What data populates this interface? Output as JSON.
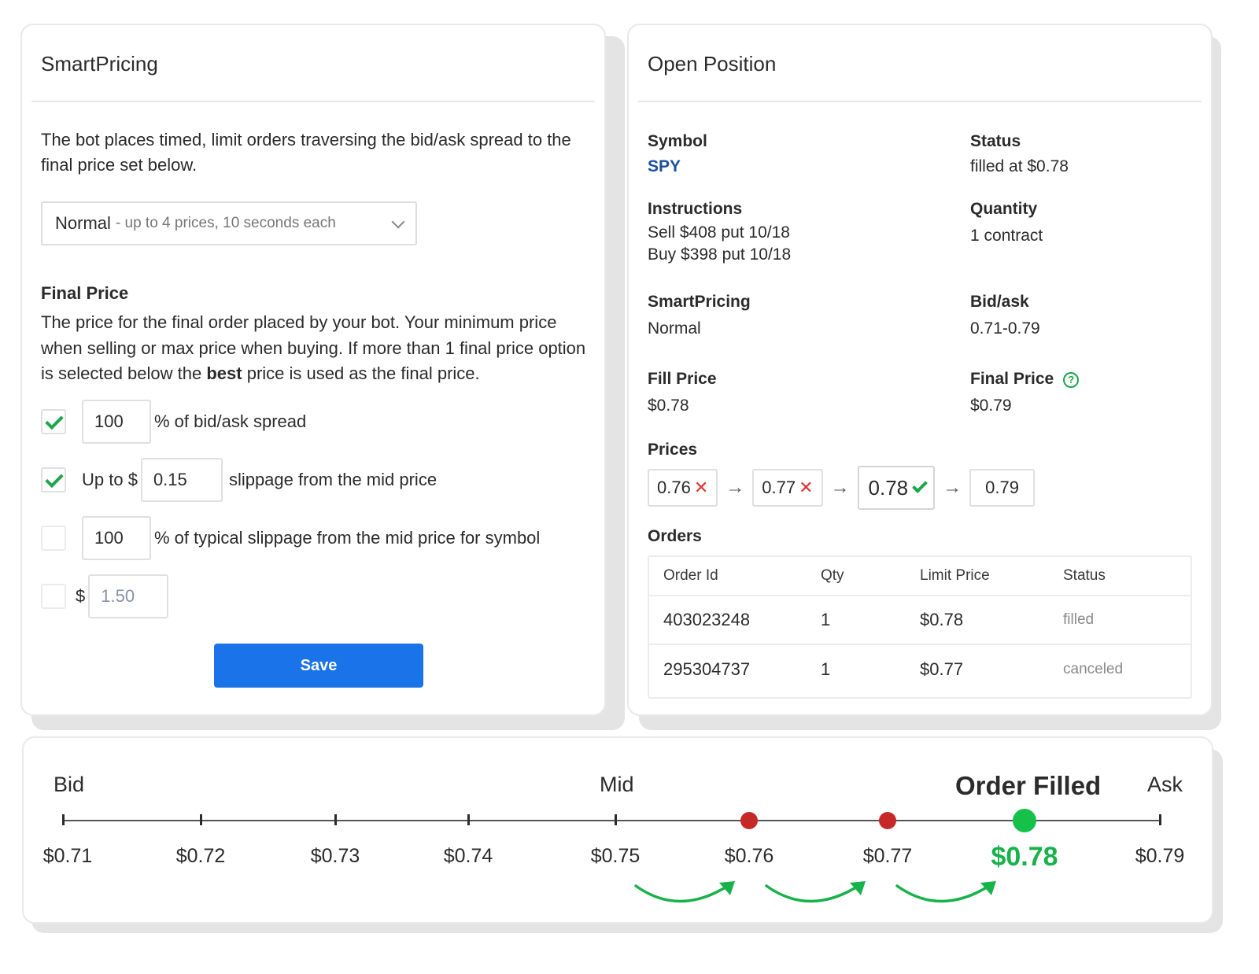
{
  "smart_pricing": {
    "title": "SmartPricing",
    "description": "The bot places timed, limit orders traversing the bid/ask spread to the final price set below.",
    "mode_select": {
      "value": "Normal",
      "detail": "- up to 4 prices, 10 seconds each"
    },
    "final_price": {
      "title": "Final Price",
      "desc_before": "The price for the final order placed by your bot. Your minimum price when selling or max price when buying. If more than 1 final price option is selected below the ",
      "desc_bold": "best",
      "desc_after": " price is used as the final price."
    },
    "options": [
      {
        "checked": true,
        "value": "100",
        "suffix": "% of bid/ask spread"
      },
      {
        "checked": true,
        "prefix": "Up to $",
        "value": "0.15",
        "suffix": "slippage from the mid price"
      },
      {
        "checked": false,
        "value": "100",
        "suffix": "% of typical slippage from the mid price for symbol"
      },
      {
        "checked": false,
        "prefix": "$",
        "value": "1.50"
      }
    ],
    "save_label": "Save"
  },
  "open_position": {
    "title": "Open Position",
    "symbol_label": "Symbol",
    "symbol_value": "SPY",
    "status_label": "Status",
    "status_value": "filled at $0.78",
    "instructions_label": "Instructions",
    "instructions_line1": "Sell $408 put 10/18",
    "instructions_line2": "Buy $398 put 10/18",
    "quantity_label": "Quantity",
    "quantity_value": "1 contract",
    "smartpricing_label": "SmartPricing",
    "smartpricing_value": "Normal",
    "bidask_label": "Bid/ask",
    "bidask_value": "0.71-0.79",
    "fill_price_label": "Fill Price",
    "fill_price_value": "$0.78",
    "final_price_label": "Final Price",
    "final_price_value": "$0.79",
    "help_glyph": "?",
    "prices_label": "Prices",
    "prices": [
      {
        "value": "0.76",
        "state": "rejected",
        "mark": "✕"
      },
      {
        "value": "0.77",
        "state": "rejected",
        "mark": "✕"
      },
      {
        "value": "0.78",
        "state": "filled"
      },
      {
        "value": "0.79",
        "state": "pending"
      }
    ],
    "arrow_glyph": "→",
    "orders_label": "Orders",
    "orders_columns": [
      "Order Id",
      "Qty",
      "Limit Price",
      "Status"
    ],
    "orders": [
      [
        "403023248",
        "1",
        "$0.78",
        "filled"
      ],
      [
        "295304737",
        "1",
        "$0.77",
        "canceled"
      ]
    ]
  },
  "timeline": {
    "bid_label": "Bid",
    "mid_label": "Mid",
    "filled_label": "Order Filled",
    "ask_label": "Ask",
    "ticks": [
      "$0.71",
      "$0.72",
      "$0.73",
      "$0.74",
      "$0.75",
      "$0.76",
      "$0.77",
      "$0.78",
      "$0.79"
    ],
    "rejected_prices": [
      "$0.76",
      "$0.77"
    ],
    "filled_price": "$0.78",
    "colors": {
      "rejected": "#c62828",
      "filled": "#16c14a",
      "arrow": "#18b24a"
    }
  }
}
